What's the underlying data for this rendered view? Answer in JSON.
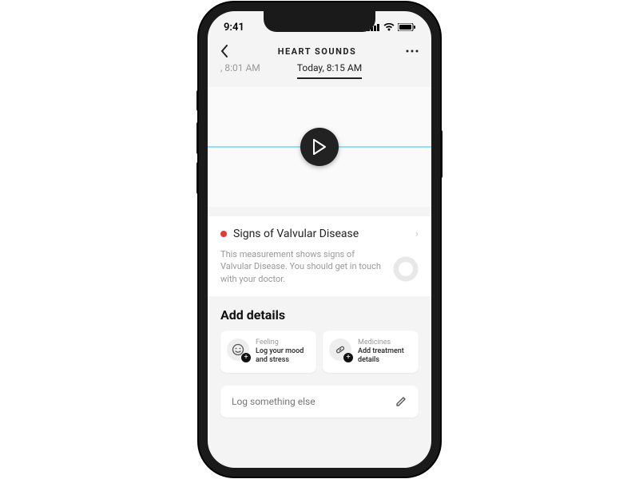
{
  "status": {
    "time": "9:41"
  },
  "nav": {
    "title": "HEART SOUNDS"
  },
  "tabs": {
    "prev": ", 8:01 AM",
    "current": "Today, 8:15 AM"
  },
  "diagnosis": {
    "title": "Signs of Valvular Disease",
    "body": "This measurement shows signs of Valvular Disease. You should get in touch with your doctor."
  },
  "details": {
    "heading": "Add details",
    "cards": [
      {
        "label": "Feeling",
        "prompt": "Log your mood and stress"
      },
      {
        "label": "Medicines",
        "prompt": "Add treatment details"
      }
    ],
    "log_else": "Log something else"
  }
}
